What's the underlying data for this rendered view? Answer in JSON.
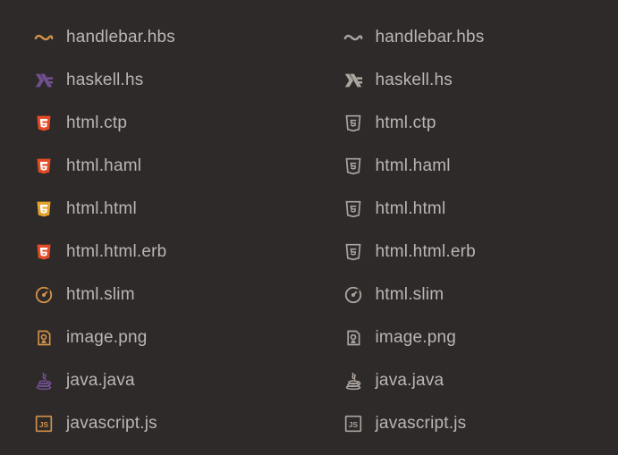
{
  "left": {
    "items": [
      {
        "icon": "handlebar-icon",
        "label": "handlebar.hbs",
        "color": "#d39148"
      },
      {
        "icon": "haskell-icon",
        "label": "haskell.hs",
        "color": "#6f4f8e"
      },
      {
        "icon": "html5-icon",
        "label": "html.ctp",
        "color": "#e34c26"
      },
      {
        "icon": "html5-icon",
        "label": "html.haml",
        "color": "#e34c26"
      },
      {
        "icon": "html5-icon",
        "label": "html.html",
        "color": "#e5a32c"
      },
      {
        "icon": "html5-icon",
        "label": "html.html.erb",
        "color": "#e34c26"
      },
      {
        "icon": "gauge-icon",
        "label": "html.slim",
        "color": "#d39148"
      },
      {
        "icon": "image-icon",
        "label": "image.png",
        "color": "#d39148"
      },
      {
        "icon": "java-icon",
        "label": "java.java",
        "color": "#6f4f8e"
      },
      {
        "icon": "js-icon",
        "label": "javascript.js",
        "color": "#d39148"
      }
    ]
  },
  "right": {
    "items": [
      {
        "icon": "handlebar-icon",
        "label": "handlebar.hbs",
        "color": "#aca49f"
      },
      {
        "icon": "haskell-icon",
        "label": "haskell.hs",
        "color": "#aca49f"
      },
      {
        "icon": "html5-icon",
        "label": "html.ctp",
        "color": "#aca49f"
      },
      {
        "icon": "html5-icon",
        "label": "html.haml",
        "color": "#aca49f"
      },
      {
        "icon": "html5-icon",
        "label": "html.html",
        "color": "#aca49f"
      },
      {
        "icon": "html5-icon",
        "label": "html.html.erb",
        "color": "#aca49f"
      },
      {
        "icon": "gauge-icon",
        "label": "html.slim",
        "color": "#aca49f"
      },
      {
        "icon": "image-icon",
        "label": "image.png",
        "color": "#aca49f"
      },
      {
        "icon": "java-icon",
        "label": "java.java",
        "color": "#aca49f"
      },
      {
        "icon": "js-icon",
        "label": "javascript.js",
        "color": "#aca49f"
      }
    ]
  }
}
